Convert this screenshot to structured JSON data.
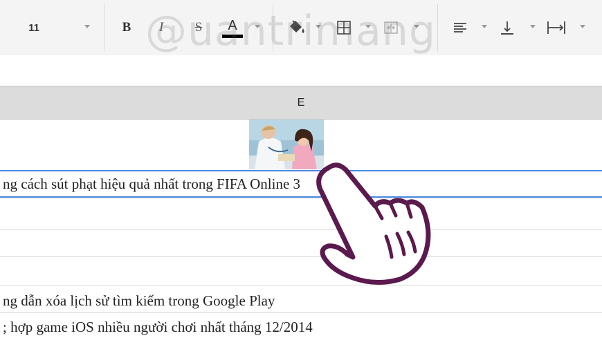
{
  "toolbar": {
    "font_size": "11",
    "bold_label": "B",
    "italic_label": "I",
    "strike_label": "S",
    "text_color_label": "A",
    "text_color": "#000000"
  },
  "watermark": {
    "text": "@uantrimang"
  },
  "column_header": {
    "label": "E"
  },
  "rows": [
    {
      "text": "ng cách sút phạt hiệu quả nhất trong FIFA Online 3"
    },
    {
      "text": ""
    },
    {
      "text": ""
    },
    {
      "text": ""
    },
    {
      "text": "ng dẫn xóa lịch sử tìm kiếm trong Google Play"
    },
    {
      "text": "; hợp game iOS nhiều người chơi nhất tháng 12/2014"
    }
  ],
  "colors": {
    "selection": "#4a8be0",
    "hand_outline": "#5b1a4e",
    "header_bg": "#dcdcdc",
    "toolbar_bg": "#f4f4f4"
  },
  "icons": [
    "fill-color-icon",
    "borders-icon",
    "merge-cells-icon",
    "align-left-icon",
    "vertical-align-bottom-icon",
    "text-wrap-icon",
    "pointing-hand-icon"
  ]
}
